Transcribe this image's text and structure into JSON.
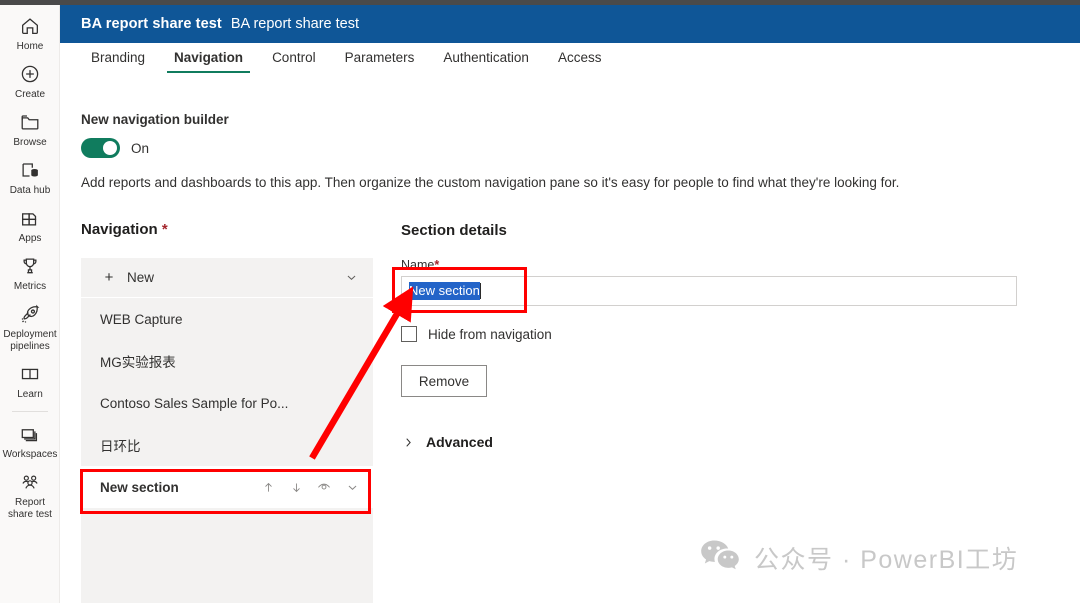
{
  "header": {
    "app_name_bold": "BA report share test",
    "app_name_regular": "BA report share test",
    "background_color": "#0f5697"
  },
  "tabs": {
    "active": "Navigation",
    "accent_color": "#107c5e",
    "items": [
      {
        "label": "Branding"
      },
      {
        "label": "Navigation"
      },
      {
        "label": "Control"
      },
      {
        "label": "Parameters"
      },
      {
        "label": "Authentication"
      },
      {
        "label": "Access"
      }
    ]
  },
  "sidebar": {
    "items": [
      {
        "label": "Home",
        "icon": "home-icon"
      },
      {
        "label": "Create",
        "icon": "plus-circle-icon"
      },
      {
        "label": "Browse",
        "icon": "folder-icon"
      },
      {
        "label": "Data hub",
        "icon": "database-icon"
      },
      {
        "label": "Apps",
        "icon": "apps-grid-icon"
      },
      {
        "label": "Metrics",
        "icon": "trophy-icon"
      },
      {
        "label": "Deployment\npipelines",
        "icon": "rocket-icon"
      },
      {
        "label": "Learn",
        "icon": "book-icon"
      },
      {
        "label": "Workspaces",
        "icon": "layers-icon"
      },
      {
        "label": "Report\nshare test",
        "icon": "people-group-icon"
      }
    ]
  },
  "builder": {
    "title": "New navigation builder",
    "toggle_state": "On",
    "toggle_on": true,
    "toggle_color": "#107c5e",
    "description": "Add reports and dashboards to this app. Then organize the custom navigation pane so it's easy for people to find what they're looking for."
  },
  "navigation_panel": {
    "title": "Navigation",
    "required_marker": "*",
    "new_button": {
      "label": "New",
      "plus": "+",
      "chevron": "chevron-down-icon"
    },
    "items": [
      {
        "label": "WEB Capture",
        "selected": false
      },
      {
        "label": "MG实验报表",
        "selected": false
      },
      {
        "label": "Contoso Sales Sample for Po...",
        "selected": false
      },
      {
        "label": "日环比",
        "selected": false
      }
    ],
    "selected_item": {
      "label": "New section",
      "selected": true,
      "actions": [
        "move-up-icon",
        "move-down-icon",
        "hide-eye-icon",
        "chevron-down-icon"
      ]
    }
  },
  "details": {
    "title": "Section details",
    "name_label": "Name",
    "name_required_marker": "*",
    "name_value": "New section",
    "name_value_selected": true,
    "hide_checkbox": {
      "label": "Hide from navigation",
      "checked": false
    },
    "remove_button": "Remove",
    "advanced": {
      "label": "Advanced",
      "expanded": false,
      "chevron": "chevron-right-icon"
    }
  },
  "annotations": {
    "color": "#ff0000",
    "boxes": [
      "name-input-highlight",
      "new-section-row-highlight"
    ],
    "arrow": "points-from-new-section-row-to-name-input"
  },
  "watermark": {
    "icon": "wechat-bubbles-icon",
    "text": "公众号 · PowerBI工坊",
    "color": "#c8c8c8"
  }
}
